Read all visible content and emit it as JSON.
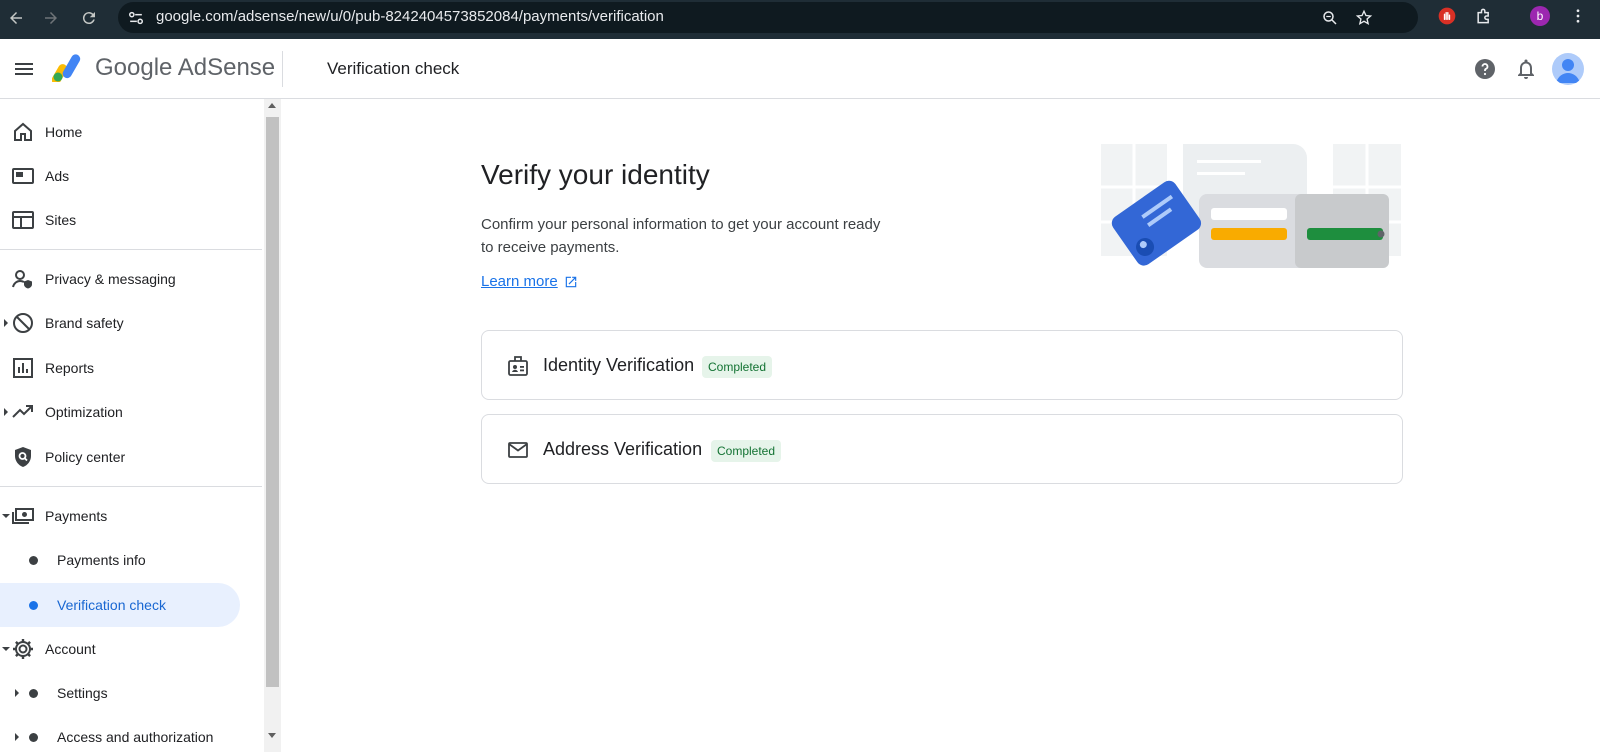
{
  "browser": {
    "url": "google.com/adsense/new/u/0/pub-8242404573852084/payments/verification",
    "profile_initial": "b"
  },
  "header": {
    "brand": "Google AdSense",
    "title": "Verification check"
  },
  "sidebar": {
    "items": [
      {
        "label": "Home",
        "icon": "home-icon"
      },
      {
        "label": "Ads",
        "icon": "ads-icon"
      },
      {
        "label": "Sites",
        "icon": "sites-icon"
      },
      {
        "label": "Privacy & messaging",
        "icon": "privacy-icon"
      },
      {
        "label": "Brand safety",
        "icon": "block-icon"
      },
      {
        "label": "Reports",
        "icon": "bar-chart-icon"
      },
      {
        "label": "Optimization",
        "icon": "trending-up-icon"
      },
      {
        "label": "Policy center",
        "icon": "policy-shield-icon"
      },
      {
        "label": "Payments",
        "icon": "payments-icon"
      },
      {
        "label": "Payments info"
      },
      {
        "label": "Verification check"
      },
      {
        "label": "Account",
        "icon": "gear-icon"
      },
      {
        "label": "Settings"
      },
      {
        "label": "Access and authorization"
      }
    ]
  },
  "main": {
    "heading": "Verify your identity",
    "description": "Confirm your personal information to get your account ready to receive payments.",
    "learn_more": "Learn more",
    "cards": [
      {
        "title": "Identity Verification",
        "status": "Completed",
        "icon": "id-badge-icon"
      },
      {
        "title": "Address Verification",
        "status": "Completed",
        "icon": "mail-icon"
      }
    ]
  },
  "colors": {
    "accent": "#1a73e8",
    "active_bg": "#e8f0fe",
    "success_bg": "#e6f4ea",
    "success_text": "#137333",
    "chrome_bg": "#1f2d36"
  }
}
